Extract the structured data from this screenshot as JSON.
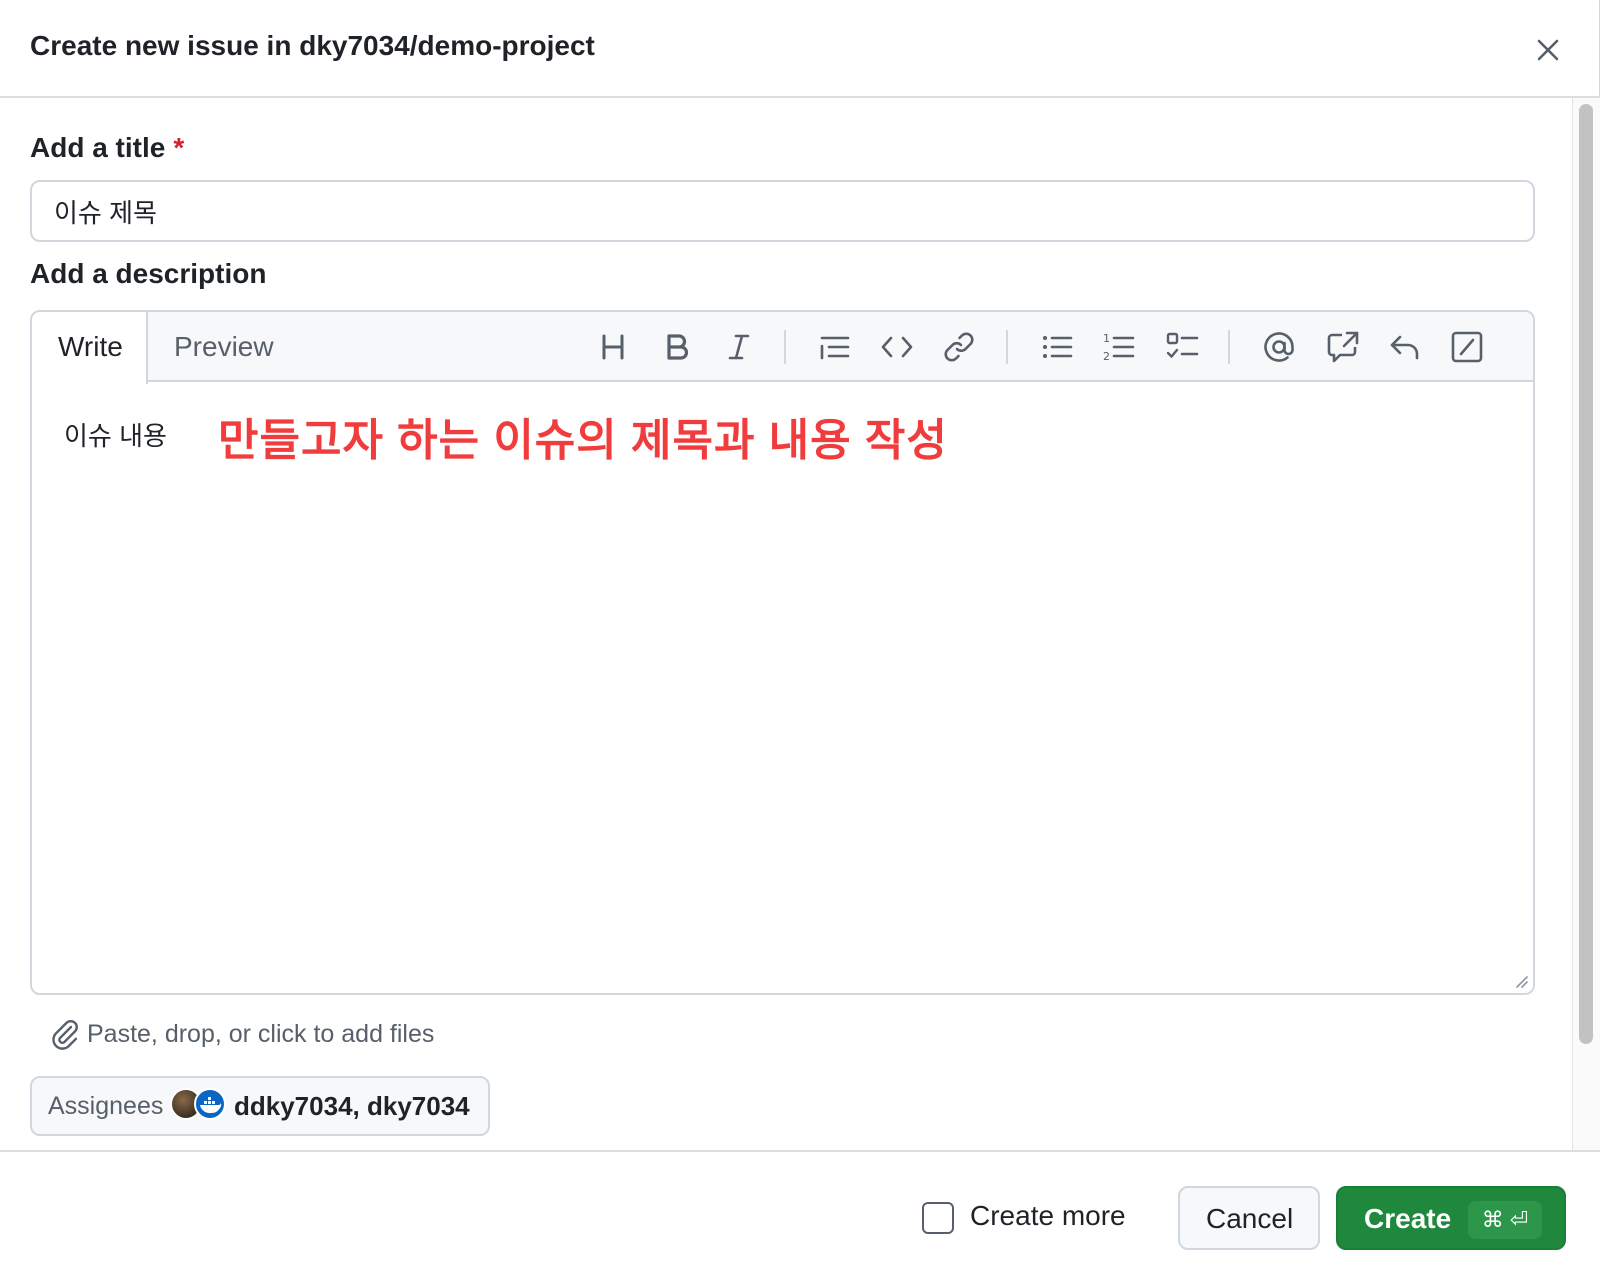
{
  "dialog": {
    "title": "Create new issue in dky7034/demo-project",
    "close_icon": "close-icon"
  },
  "form": {
    "title_label": "Add a title",
    "required_marker": "*",
    "title_value": "이슈 제목",
    "description_label": "Add a description"
  },
  "editor": {
    "tabs": [
      {
        "label": "Write",
        "active": true
      },
      {
        "label": "Preview",
        "active": false
      }
    ],
    "toolbar_icons": [
      "heading-icon",
      "bold-icon",
      "italic-icon",
      "quote-icon",
      "code-icon",
      "link-icon",
      "unordered-list-icon",
      "ordered-list-icon",
      "task-list-icon",
      "mention-icon",
      "cross-reference-icon",
      "saved-reply-icon",
      "slash-command-icon"
    ],
    "body_text": "이슈 내용",
    "annotation": "만들고자 하는 이슈의 제목과 내용 작성"
  },
  "attach": {
    "label": "Paste, drop, or click to add files"
  },
  "assignees": {
    "label": "Assignees",
    "names": "ddky7034, dky7034"
  },
  "footer": {
    "create_more_label": "Create more",
    "create_more_checked": false,
    "cancel_label": "Cancel",
    "create_label": "Create",
    "create_shortcut": "⌘ ⏎"
  },
  "colors": {
    "primary_button": "#1f883d",
    "annotation": "#f03c3c",
    "required": "#cf222e"
  }
}
